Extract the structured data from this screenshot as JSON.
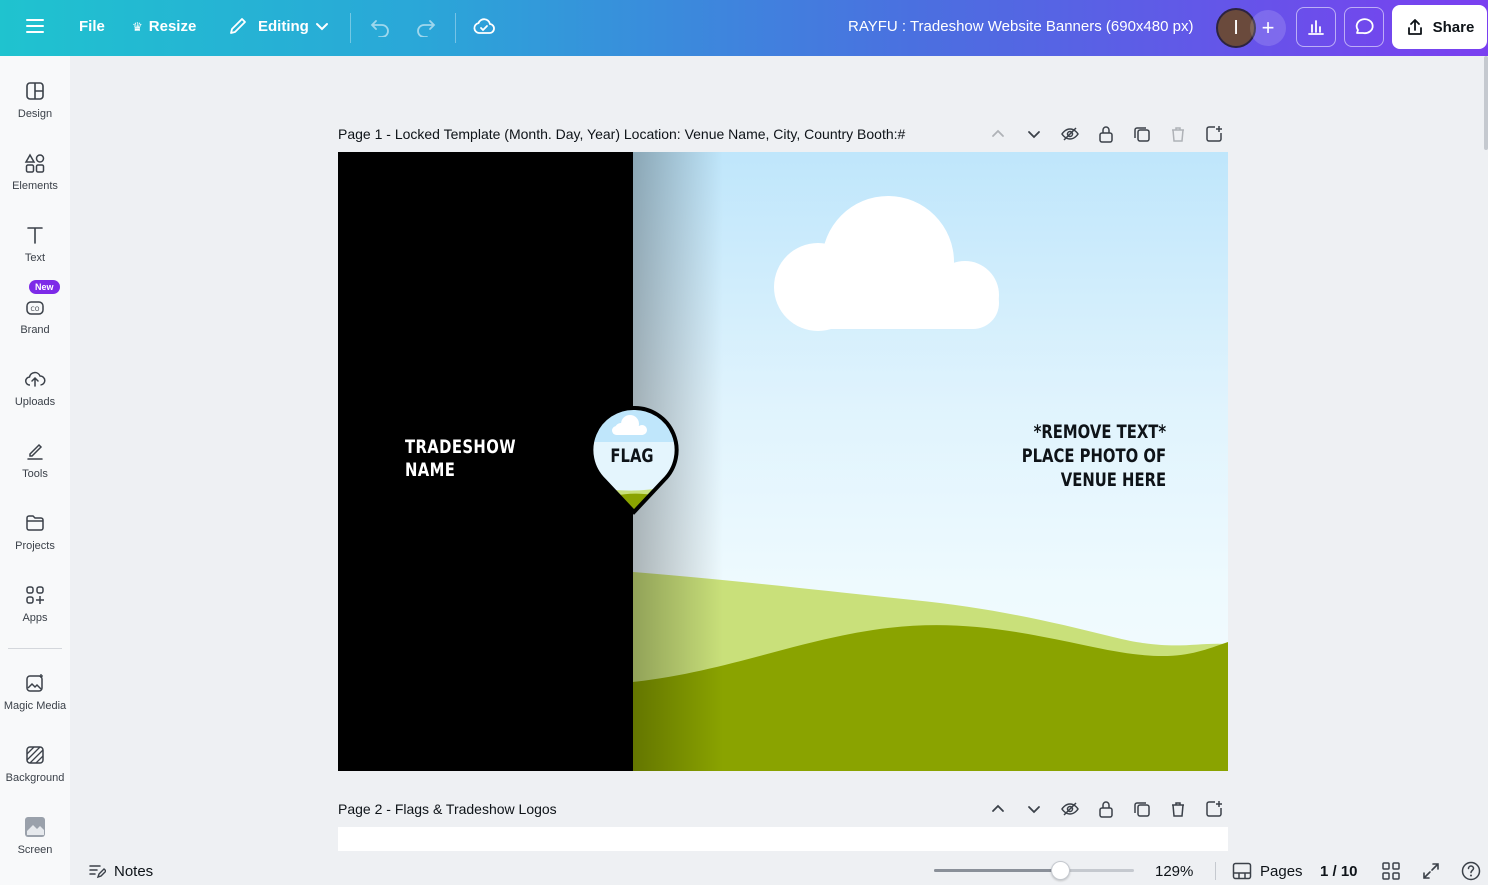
{
  "topbar": {
    "file_label": "File",
    "resize_label": "Resize",
    "editing_label": "Editing",
    "title": "RAYFU : Tradeshow Website Banners (690x480 px)",
    "avatar_initial": "I",
    "share_label": "Share"
  },
  "sidebar": {
    "items": [
      {
        "label": "Design",
        "icon": "design-icon"
      },
      {
        "label": "Elements",
        "icon": "elements-icon"
      },
      {
        "label": "Text",
        "icon": "text-icon"
      },
      {
        "label": "Brand",
        "icon": "brand-icon"
      },
      {
        "label": "Uploads",
        "icon": "uploads-icon"
      },
      {
        "label": "Tools",
        "icon": "tools-icon"
      },
      {
        "label": "Projects",
        "icon": "projects-icon"
      },
      {
        "label": "Apps",
        "icon": "apps-icon"
      },
      {
        "label": "Magic Media",
        "icon": "magic-media-icon"
      },
      {
        "label": "Background",
        "icon": "background-icon"
      },
      {
        "label": "Screen",
        "icon": "screen-icon"
      }
    ],
    "new_badge": "New"
  },
  "pages": [
    {
      "header": "Page 1 -  Locked Template (Month. Day, Year)   Location: Venue Name, City, Country   Booth:#",
      "tradeshow_name": "TRADESHOW\nNAME",
      "flag_label": "FLAG",
      "remove_text": "*REMOVE TEXT*\nPLACE PHOTO OF\nVENUE HERE"
    },
    {
      "header": "Page 2 - Flags & Tradeshow Logos"
    }
  ],
  "footer": {
    "notes_label": "Notes",
    "zoom_level": "129%",
    "zoom_fraction": 0.63,
    "pages_label": "Pages",
    "page_count": "1 / 10"
  },
  "colors": {
    "accent": "#7d2ae8",
    "grass_dark": "#8aa300",
    "grass_light": "#c9e07a",
    "sky": "#bfe6fb"
  }
}
